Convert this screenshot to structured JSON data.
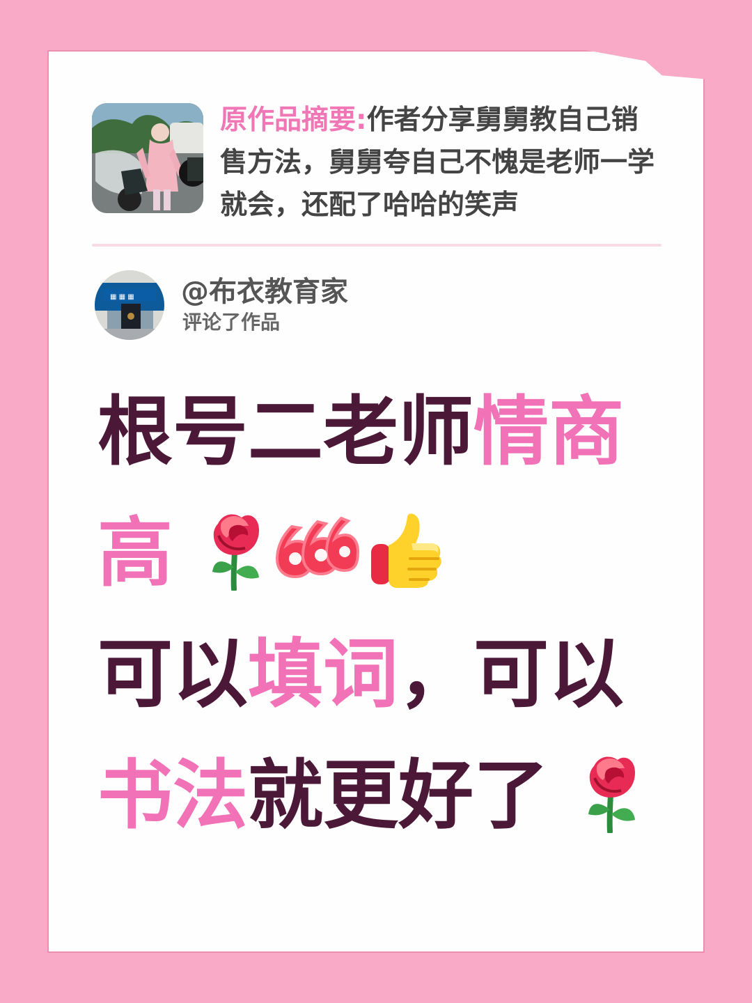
{
  "summary": {
    "label": "原作品摘要:",
    "text": "作者分享舅舅教自己销售方法，舅舅夸自己不愧是老师一学就会，还配了哈哈的笑声"
  },
  "author": {
    "name": "@布衣教育家",
    "action": "评论了作品"
  },
  "comment": {
    "line1_dark": "根号二老师",
    "line1_hl": "情商",
    "line2_hl": "高",
    "line3_dark_a": "可以",
    "line3_hl": "填词",
    "line3_dark_b": "，可以",
    "line4_hl": "书法",
    "line4_dark": "就更好了"
  },
  "icons": {
    "rose": "rose-icon",
    "six": "six-six-six-icon",
    "thumb": "thumbs-up-icon"
  },
  "colors": {
    "background": "#f8aac6",
    "accent": "#f172b6",
    "text_dark": "#4b1838"
  }
}
